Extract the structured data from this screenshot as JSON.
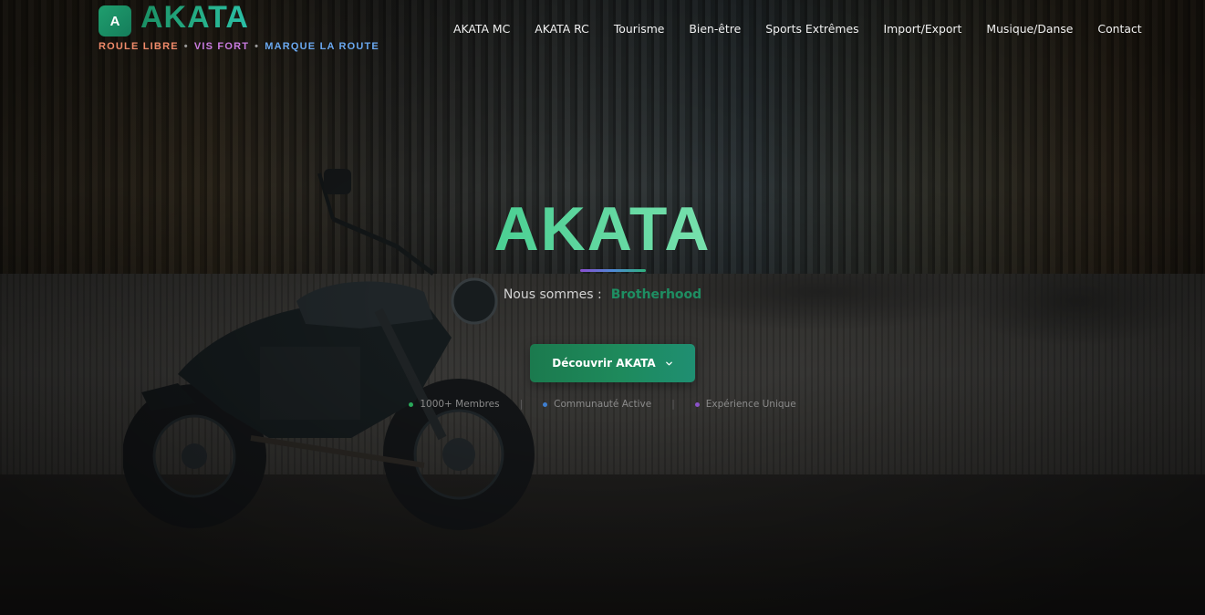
{
  "brand": {
    "badge_letter": "A",
    "name": "AKATA",
    "tagline": [
      {
        "text": "ROULE LIBRE",
        "color": "#f08a6a"
      },
      {
        "text": "VIS FORT",
        "color": "#c97be0"
      },
      {
        "text": "MARQUE LA ROUTE",
        "color": "#6aa8f0"
      }
    ],
    "separator": "•"
  },
  "nav": {
    "items": [
      "AKATA MC",
      "AKATA RC",
      "Tourisme",
      "Bien-être",
      "Sports Extrêmes",
      "Import/Export",
      "Musique/Danse",
      "Contact"
    ]
  },
  "hero": {
    "title": "AKATA",
    "subtitle_label": "Nous sommes :",
    "subtitle_value": "Brotherhood",
    "cta_label": "Découvrir AKATA",
    "cta_icon": "chevron-down-icon",
    "stats": [
      {
        "label": "1000+ Membres",
        "color": "#2aa85a"
      },
      {
        "label": "Communauté Active",
        "color": "#3f7fd0"
      },
      {
        "label": "Expérience Unique",
        "color": "#8a52c8"
      }
    ],
    "stat_separator": "|"
  },
  "colors": {
    "accent_green": "#1e8e62",
    "cta_gradient_start": "#1b7a4e",
    "cta_gradient_end": "#1f8f72"
  }
}
